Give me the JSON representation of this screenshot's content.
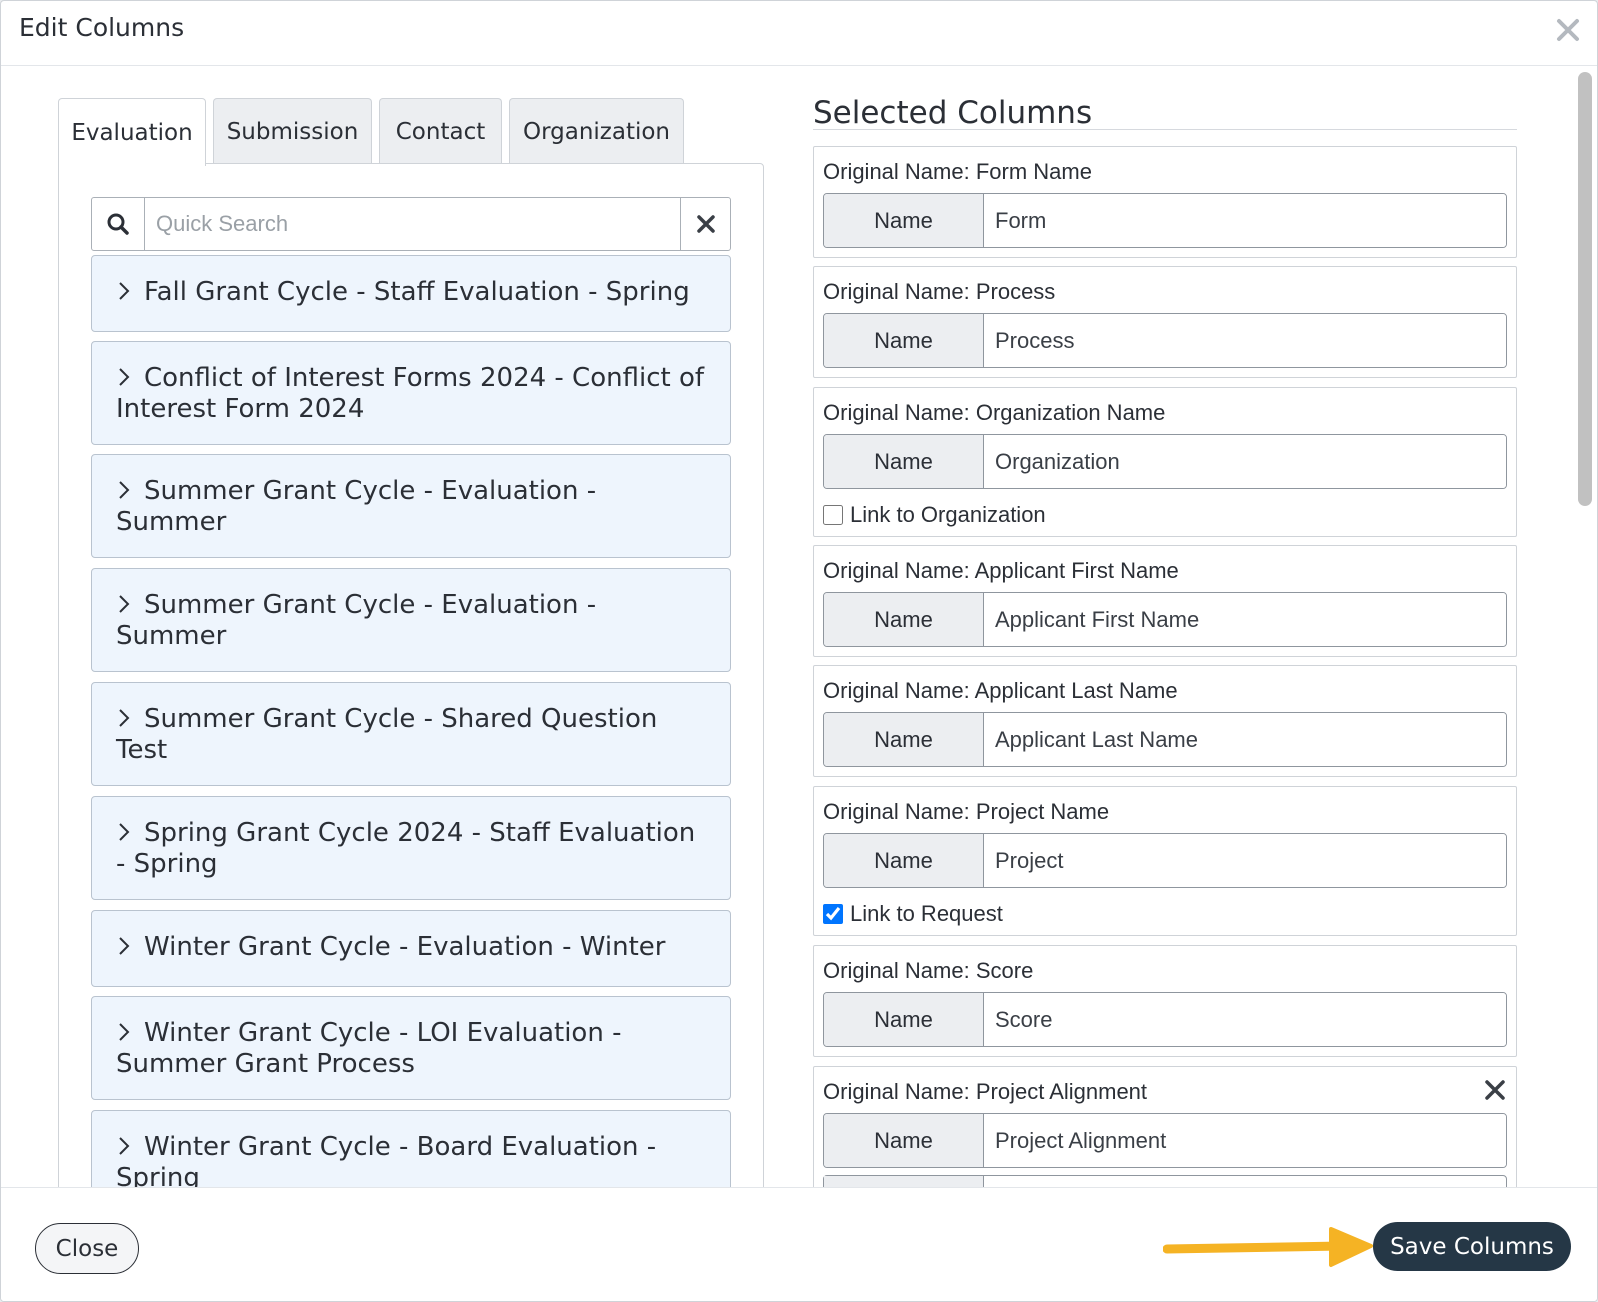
{
  "header": {
    "title": "Edit Columns"
  },
  "tabs": [
    {
      "label": "Evaluation",
      "active": true
    },
    {
      "label": "Submission",
      "active": false
    },
    {
      "label": "Contact",
      "active": false
    },
    {
      "label": "Organization",
      "active": false
    }
  ],
  "search": {
    "placeholder": "Quick Search",
    "value": ""
  },
  "groups": [
    {
      "label": "Fall Grant Cycle - Staff Evaluation - Spring"
    },
    {
      "label": "Conflict of Interest Forms 2024 - Conflict of Interest Form 2024"
    },
    {
      "label": "Summer Grant Cycle - Evaluation - Summer"
    },
    {
      "label": "Summer Grant Cycle - Evaluation - Summer"
    },
    {
      "label": "Summer Grant Cycle - Shared Question Test"
    },
    {
      "label": "Spring Grant Cycle 2024 - Staff Evaluation - Spring"
    },
    {
      "label": "Winter Grant Cycle - Evaluation - Winter"
    },
    {
      "label": "Winter Grant Cycle - LOI Evaluation - Summer Grant Process"
    },
    {
      "label": "Winter Grant Cycle - Board Evaluation - Spring"
    }
  ],
  "selected": {
    "title": "Selected Columns",
    "addon_label": "Name",
    "columns": [
      {
        "original": "Original Name: Form Name",
        "value": "Form"
      },
      {
        "original": "Original Name: Process",
        "value": "Process"
      },
      {
        "original": "Original Name: Organization Name",
        "value": "Organization",
        "checkbox_label": "Link to Organization",
        "checked": false
      },
      {
        "original": "Original Name: Applicant First Name",
        "value": "Applicant First Name"
      },
      {
        "original": "Original Name: Applicant Last Name",
        "value": "Applicant Last Name"
      },
      {
        "original": "Original Name: Project Name",
        "value": "Project",
        "checkbox_label": "Link to Request",
        "checked": true
      },
      {
        "original": "Original Name: Score",
        "value": "Score"
      },
      {
        "original": "Original Name: Project Alignment",
        "value": "Project Alignment",
        "removable": true
      }
    ]
  },
  "footer": {
    "close_label": "Close",
    "save_label": "Save Columns"
  },
  "colors": {
    "primary": "#253746",
    "accent_arrow": "#f5b324",
    "group_bg": "#eef5fd"
  }
}
